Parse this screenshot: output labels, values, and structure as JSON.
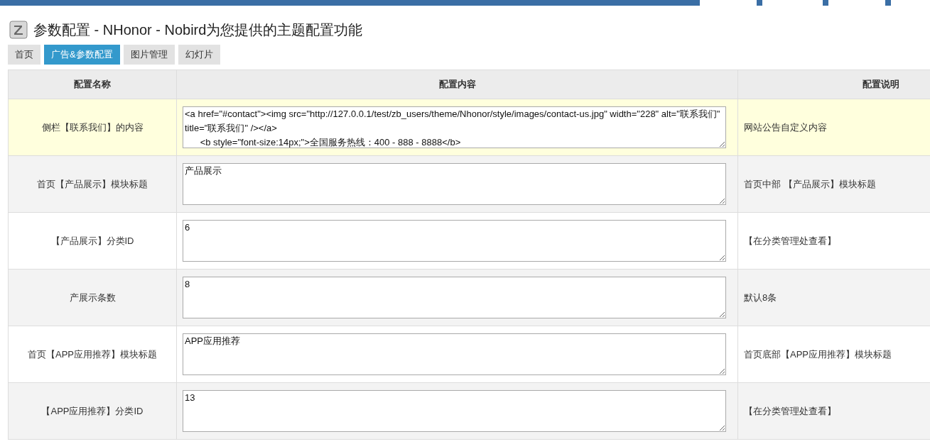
{
  "title": "参数配置 - NHonor - Nobird为您提供的主题配置功能",
  "tabs": [
    {
      "label": "首页",
      "selected": false
    },
    {
      "label": "广告&参数配置",
      "selected": true
    },
    {
      "label": "图片管理",
      "selected": false
    },
    {
      "label": "幻灯片",
      "selected": false
    }
  ],
  "table": {
    "columns": [
      "配置名称",
      "配置内容",
      "配置说明"
    ],
    "rows": [
      {
        "name": "侧栏【联系我们】的内容",
        "value": "<a href=\"#contact\"><img src=\"http://127.0.0.1/test/zb_users/theme/Nhonor/style/images/contact-us.jpg\" width=\"228\" alt=\"联系我们\" title=\"联系我们\" /></a>\n      <b style=\"font-size:14px;\">全国服务热线：400 - 888 - 8888</b>",
        "note": "网站公告自定义内容",
        "highlighted": true
      },
      {
        "name": "首页【产品展示】模块标题",
        "value": "产品展示",
        "note": "首页中部 【产品展示】模块标题",
        "highlighted": false
      },
      {
        "name": "【产品展示】分类ID",
        "value": "6",
        "note": "【在分类管理处查看】",
        "highlighted": false
      },
      {
        "name": "产展示条数",
        "value": "8",
        "note": "默认8条",
        "highlighted": false
      },
      {
        "name": "首页【APP应用推荐】模块标题",
        "value": "APP应用推荐",
        "note": "首页底部【APP应用推荐】模块标题",
        "highlighted": false
      },
      {
        "name": "【APP应用推荐】分类ID",
        "value": "13",
        "note": "【在分类管理处查看】",
        "highlighted": false
      }
    ]
  }
}
